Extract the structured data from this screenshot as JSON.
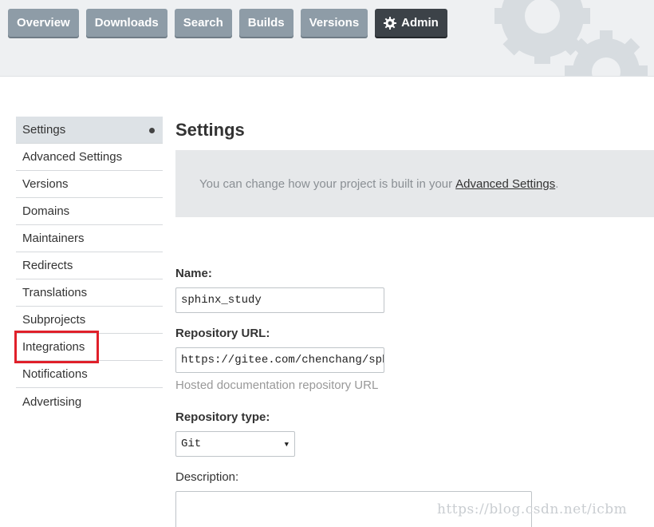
{
  "nav": {
    "items": [
      {
        "label": "Overview"
      },
      {
        "label": "Downloads"
      },
      {
        "label": "Search"
      },
      {
        "label": "Builds"
      },
      {
        "label": "Versions"
      },
      {
        "label": "Admin",
        "icon": "gear-icon",
        "active": true
      }
    ]
  },
  "sidebar": {
    "items": [
      {
        "label": "Settings",
        "active": true
      },
      {
        "label": "Advanced Settings"
      },
      {
        "label": "Versions"
      },
      {
        "label": "Domains"
      },
      {
        "label": "Maintainers"
      },
      {
        "label": "Redirects"
      },
      {
        "label": "Translations"
      },
      {
        "label": "Subprojects"
      },
      {
        "label": "Integrations",
        "highlighted": true
      },
      {
        "label": "Notifications"
      },
      {
        "label": "Advertising"
      }
    ]
  },
  "main": {
    "title": "Settings",
    "notice": {
      "text": "You can change how your project is built in your",
      "link": "Advanced Settings",
      "suffix": "."
    },
    "form": {
      "name_label": "Name:",
      "name_value": "sphinx_study",
      "repo_url_label": "Repository URL:",
      "repo_url_value": "https://gitee.com/chenchang/sphinx_study",
      "repo_url_help": "Hosted documentation repository URL",
      "repo_type_label": "Repository type:",
      "repo_type_value": "Git",
      "description_label": "Description:"
    }
  },
  "watermark": "https://blog.csdn.net/icbm",
  "colors": {
    "nav_button": "#8e9ca7",
    "nav_active": "#3c4248",
    "highlight_border": "#e0202a"
  }
}
